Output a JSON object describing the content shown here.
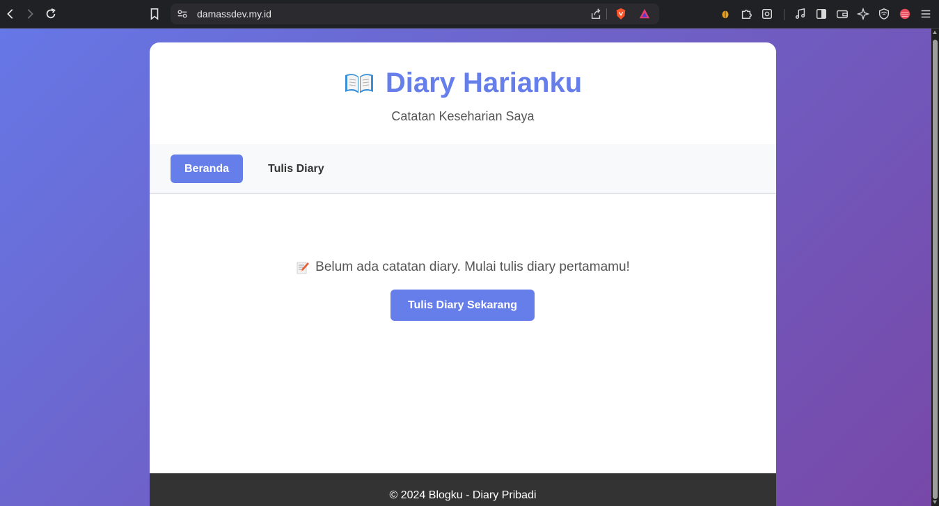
{
  "browser": {
    "url": "damassdev.my.id",
    "icons": [
      "back-icon",
      "forward-icon",
      "reload-icon",
      "bookmark-icon",
      "site-settings-icon",
      "share-icon",
      "brave-shield-icon",
      "brave-rewards-icon",
      "extension-bug-icon",
      "extensions-icon",
      "screenshot-icon",
      "media-icon",
      "sidebar-icon",
      "wallet-icon",
      "leo-ai-icon",
      "vpn-icon",
      "profile-icon",
      "menu-icon"
    ]
  },
  "site": {
    "title": "Diary Harianku",
    "subtitle": "Catatan Keseharian Saya",
    "title_color": "#667eea",
    "title_icon": "open-book-icon"
  },
  "nav": {
    "items": [
      {
        "label": "Beranda",
        "active": true
      },
      {
        "label": "Tulis Diary",
        "active": false
      }
    ]
  },
  "main": {
    "empty_message": "Belum ada catatan diary. Mulai tulis diary pertamamu!",
    "empty_icon": "memo-icon",
    "cta_label": "Tulis Diary Sekarang"
  },
  "footer": {
    "text": "© 2024 Blogku - Diary Pribadi"
  },
  "colors": {
    "accent": "#667eea",
    "gradient_start": "#6677e6",
    "gradient_end": "#7748a8",
    "footer_bg": "#333333"
  }
}
